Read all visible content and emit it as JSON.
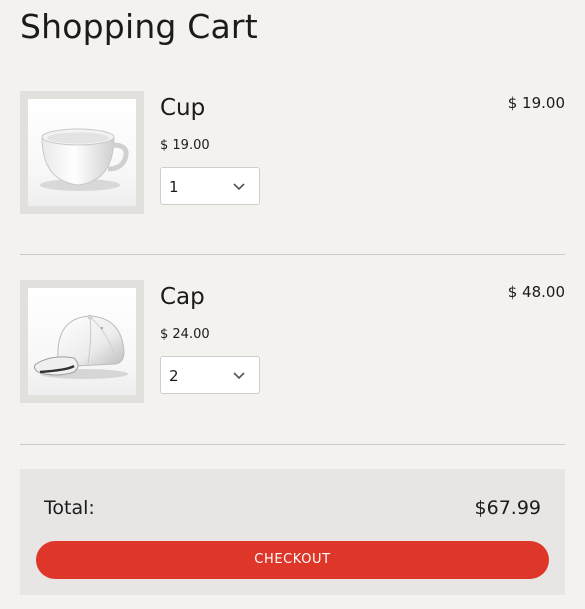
{
  "page": {
    "title": "Shopping Cart"
  },
  "items": [
    {
      "name": "Cup",
      "unit_price": "$ 19.00",
      "quantity": "1",
      "line_total": "$ 19.00",
      "image_icon": "cup-image"
    },
    {
      "name": "Cap",
      "unit_price": "$ 24.00",
      "quantity": "2",
      "line_total": "$ 48.00",
      "image_icon": "cap-image"
    }
  ],
  "summary": {
    "total_label": "Total:",
    "total_value": "$67.99",
    "checkout_label": "CHECKOUT"
  },
  "colors": {
    "background": "#f4f2ef",
    "summary_background": "#e7e6e5",
    "accent": "#de3628",
    "divider": "#cdcbc8"
  }
}
